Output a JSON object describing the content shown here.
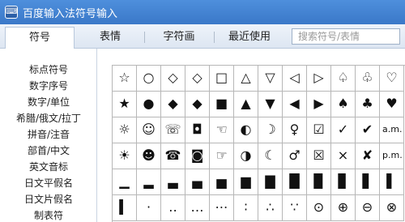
{
  "window": {
    "title": "百度输入法符号输入",
    "icon": "ime-logo-icon"
  },
  "tabs": [
    "符号",
    "表情",
    "字符画",
    "最近使用"
  ],
  "search": {
    "placeholder": "搜索符号/表情"
  },
  "categories": [
    "标点符号",
    "数字序号",
    "数字/单位",
    "希腊/俄文/拉丁",
    "拼音/注音",
    "部首/中文",
    "英文音标",
    "日文平假名",
    "日文片假名",
    "制表符"
  ],
  "symbols": [
    [
      "☆",
      "○",
      "◇",
      "◇",
      "□",
      "△",
      "▽",
      "◁",
      "▷",
      "♤",
      "♧",
      "♡"
    ],
    [
      "★",
      "●",
      "◆",
      "◆",
      "■",
      "▲",
      "▼",
      "◀",
      "▶",
      "♠",
      "♣",
      "♥"
    ],
    [
      "☼",
      "☺",
      "☏",
      "◘",
      "☜",
      "◐",
      "☽",
      "♀",
      "☑",
      "✓",
      "✔",
      "a.m."
    ],
    [
      "☀",
      "☻",
      "☎",
      "◙",
      "☞",
      "◑",
      "☾",
      "♂",
      "☒",
      "×",
      "✘",
      "p.m."
    ],
    [
      "▁",
      "▂",
      "▃",
      "▄",
      "▅",
      "▆",
      "▇",
      "█",
      "▉",
      "▊",
      "▋",
      "▌"
    ],
    [
      "▍",
      "·",
      "‥",
      "…",
      "⋯",
      "∶",
      "∴",
      "∵",
      "⊙",
      "⊕",
      "⊖",
      "⊗"
    ]
  ]
}
